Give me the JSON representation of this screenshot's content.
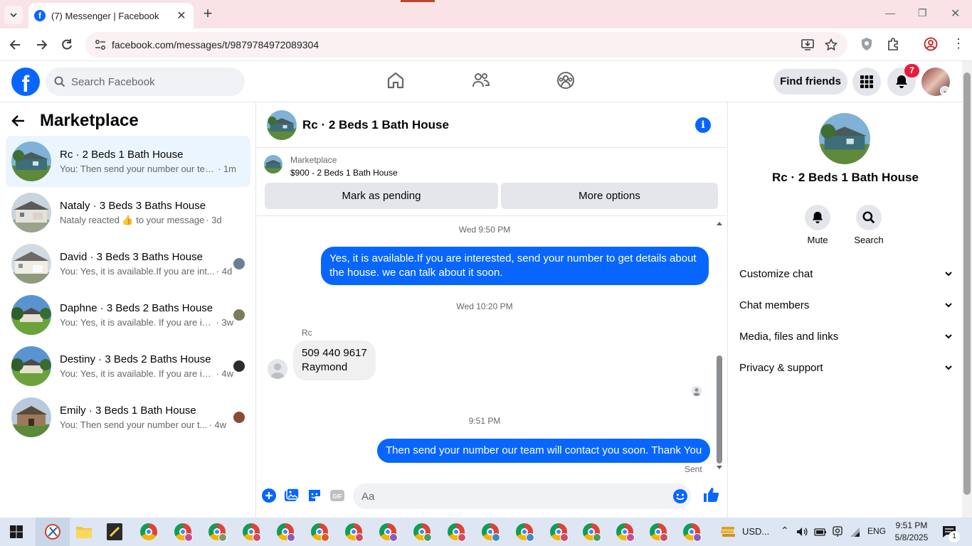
{
  "browser": {
    "tab_title": "(7) Messenger | Facebook",
    "url": "facebook.com/messages/t/9879784972089304"
  },
  "fb_header": {
    "search_placeholder": "Search Facebook",
    "find_friends_label": "Find friends",
    "notification_count": "7"
  },
  "sidebar": {
    "title": "Marketplace",
    "conversations": [
      {
        "name": "Rc · 2 Beds 1 Bath House",
        "snippet": "You: Then send your number our tea...",
        "time": "· 1m",
        "active": true
      },
      {
        "name": "Nataly · 3 Beds 3 Baths House",
        "snippet": "Nataly reacted 👍 to your message",
        "time": "· 3d",
        "active": false
      },
      {
        "name": "David · 3 Beds 3 Baths House",
        "snippet": "You: Yes, it is available.If you are int...",
        "time": "· 4d",
        "active": false
      },
      {
        "name": "Daphne · 3 Beds 2 Baths House",
        "snippet": "You: Yes, it is available. If you are in...",
        "time": "· 3w",
        "active": false
      },
      {
        "name": "Destiny · 3 Beds 2 Baths House",
        "snippet": "You: Yes, it is available. If you are in...",
        "time": "· 4w",
        "active": false
      },
      {
        "name": "Emily · 3 Beds 1 Bath House",
        "snippet": "You: Then send your number our t...",
        "time": "· 4w",
        "active": false
      }
    ]
  },
  "chat": {
    "title": "Rc · 2 Beds 1 Bath House",
    "listing_tag": "Marketplace",
    "listing_price": "$900 - 2 Beds 1 Bath House",
    "mark_pending_label": "Mark as pending",
    "more_options_label": "More options",
    "messages": {
      "ts1": "Wed 9:50 PM",
      "out1": "Yes, it is available.If you are interested, send your number to get details about the house. we can talk about it soon.",
      "ts2": "Wed 10:20 PM",
      "sender": "Rc",
      "in1_line1": "509 440 9617",
      "in1_line2": "Raymond",
      "ts3": "9:51 PM",
      "out2": "Then send your number our team will contact you soon. Thank You",
      "status": "Sent"
    },
    "composer_placeholder": "Aa"
  },
  "details": {
    "title": "Rc · 2 Beds 1 Bath House",
    "mute_label": "Mute",
    "search_label": "Search",
    "sections": [
      "Customize chat",
      "Chat members",
      "Media, files and links",
      "Privacy & support"
    ]
  },
  "taskbar": {
    "currency": "USD...",
    "language": "ENG",
    "time": "9:51 PM",
    "date": "5/8/2025",
    "notification_count": "1"
  },
  "colors": {
    "brand_blue": "#0866ff",
    "active_conv_bg": "#ebf5ff",
    "badge_red": "#e41e3f",
    "tab_strip": "#f9e3e7"
  }
}
